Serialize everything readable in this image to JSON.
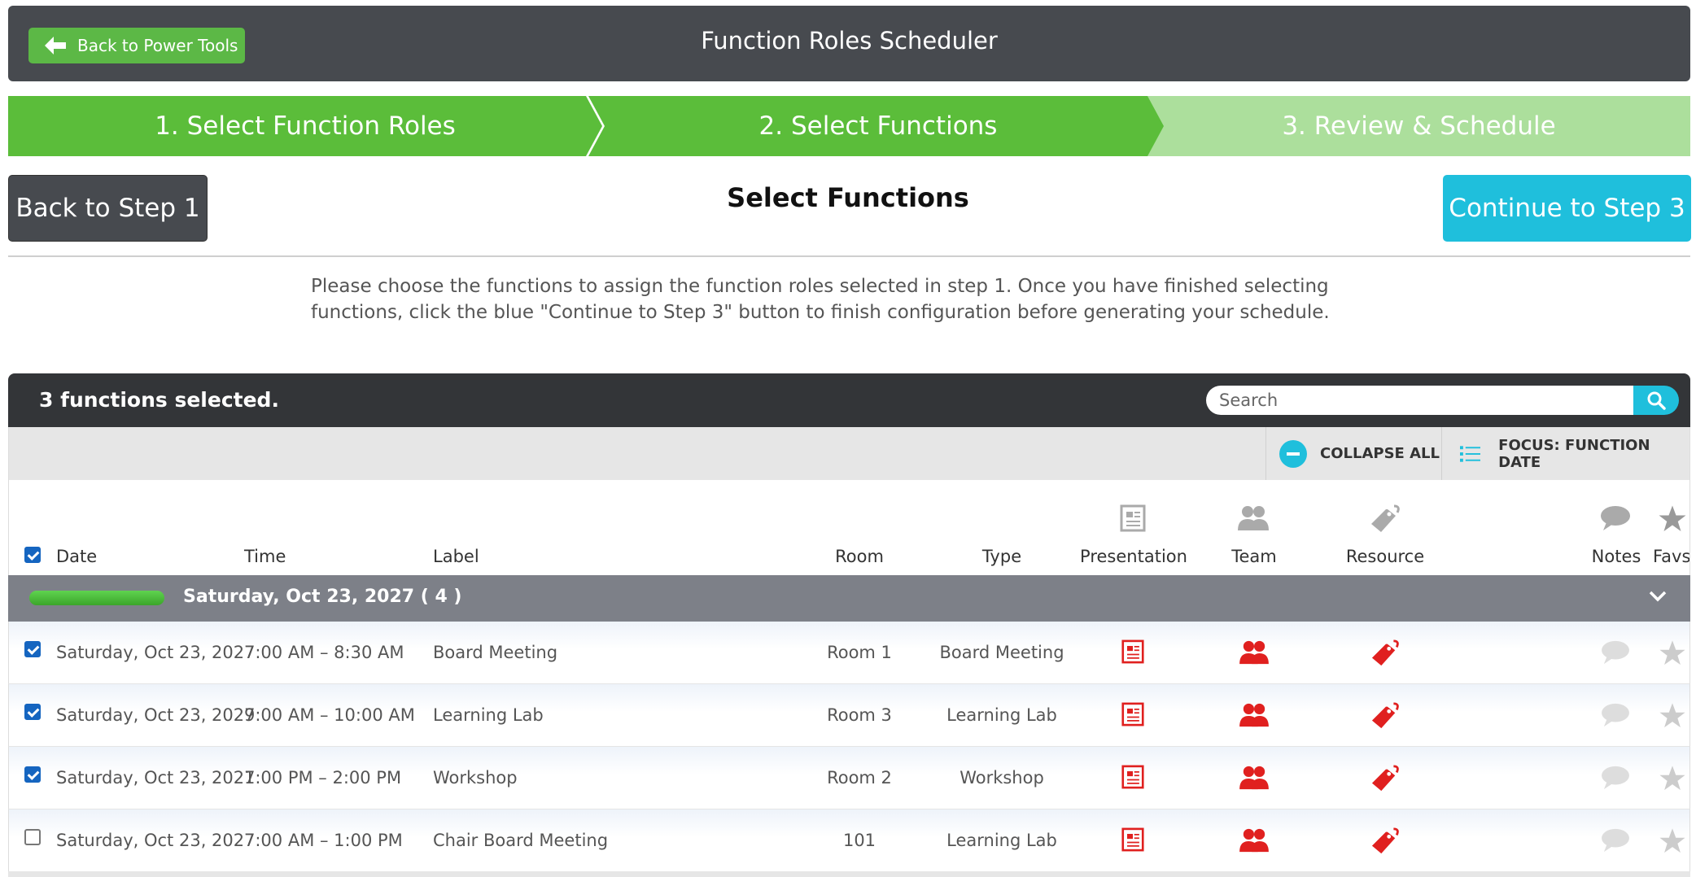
{
  "header": {
    "back_label": "Back to Power Tools",
    "title": "Function Roles Scheduler"
  },
  "steps": [
    {
      "label": "1. Select Function Roles",
      "state": "complete"
    },
    {
      "label": "2. Select Functions",
      "state": "active"
    },
    {
      "label": "3. Review & Schedule",
      "state": "pending"
    }
  ],
  "section": {
    "back_label": "Back to Step 1",
    "title": "Select Functions",
    "continue_label": "Continue to Step 3",
    "instructions": "Please choose the functions to assign the function roles selected in step 1. Once you have finished selecting functions, click the blue \"Continue to Step 3\" button to finish configuration before generating your schedule."
  },
  "panel": {
    "selected_count": "3 functions selected.",
    "search_placeholder": "Search",
    "collapse_all": "COLLAPSE ALL",
    "focus": "FOCUS: FUNCTION DATE"
  },
  "columns": {
    "date": "Date",
    "time": "Time",
    "label": "Label",
    "room": "Room",
    "type": "Type",
    "presentation": "Presentation",
    "team": "Team",
    "resource": "Resource",
    "notes": "Notes",
    "favs": "Favs"
  },
  "group": {
    "title": "Saturday, Oct 23, 2027   ( 4 )",
    "progress": 1.0
  },
  "rows": [
    {
      "checked": true,
      "date": "Saturday, Oct 23, 2027",
      "time": "7:00 AM – 8:30 AM",
      "label": "Board Meeting",
      "room": "Room 1",
      "type": "Board Meeting"
    },
    {
      "checked": true,
      "date": "Saturday, Oct 23, 2027",
      "time": "9:00 AM – 10:00 AM",
      "label": "Learning Lab",
      "room": "Room 3",
      "type": "Learning Lab"
    },
    {
      "checked": true,
      "date": "Saturday, Oct 23, 2027",
      "time": "1:00 PM – 2:00 PM",
      "label": "Workshop",
      "room": "Room 2",
      "type": "Workshop"
    },
    {
      "checked": false,
      "date": "Saturday, Oct 23, 2027",
      "time": "7:00 AM – 1:00 PM",
      "label": "Chair Board Meeting",
      "room": "101",
      "type": "Learning Lab"
    }
  ],
  "colors": {
    "header_bg": "#474a4f",
    "step_active": "#5bbd3a",
    "step_pending": "#acdf9c",
    "accent": "#1fbfdc",
    "icon_red": "#e0201f"
  }
}
